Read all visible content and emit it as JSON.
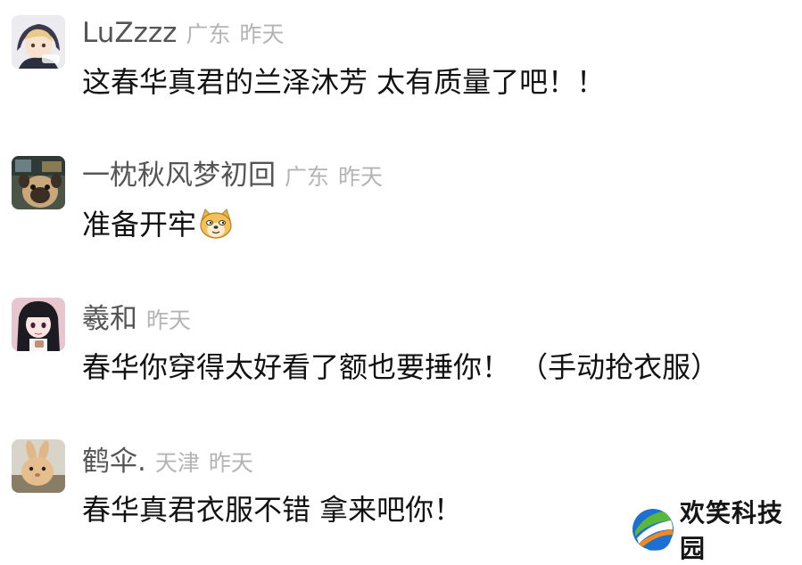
{
  "comments": [
    {
      "username": "LuZzzz",
      "location": "广东",
      "time": "昨天",
      "text": "这春华真君的兰泽沐芳 太有质量了吧！！",
      "avatar_icon": "anime-boy-avatar-icon"
    },
    {
      "username": "一枕秋风梦初回",
      "location": "广东",
      "time": "昨天",
      "text": "准备开牢",
      "emoji_icon": "doge-emoji-icon",
      "avatar_icon": "pug-avatar-icon"
    },
    {
      "username": "羲和",
      "location": "",
      "time": "昨天",
      "text": "春华你穿得太好看了额也要捶你！ （手动抢衣服）",
      "avatar_icon": "anime-girl-avatar-icon"
    },
    {
      "username": "鹤伞.",
      "location": "天津",
      "time": "昨天",
      "text": "春华真君衣服不错 拿来吧你！",
      "avatar_icon": "rabbit-avatar-icon"
    }
  ],
  "watermark": {
    "text": "欢笑科技园",
    "logo_icon": "tech-park-logo-icon",
    "colors": {
      "blue": "#1d6fd1",
      "green": "#5bb63c",
      "orange": "#f08a1c"
    }
  }
}
